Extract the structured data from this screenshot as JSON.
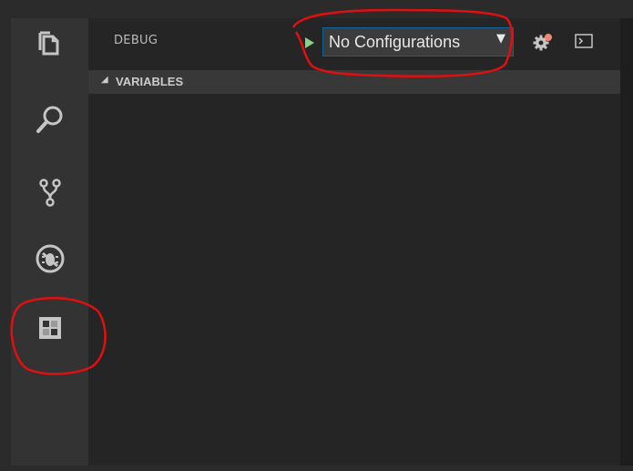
{
  "activity_bar": {
    "items": [
      {
        "icon": "explorer-icon"
      },
      {
        "icon": "search-icon"
      },
      {
        "icon": "source-control-icon"
      },
      {
        "icon": "debug-icon"
      },
      {
        "icon": "extensions-icon"
      }
    ]
  },
  "debug": {
    "title": "DEBUG",
    "configuration": "No Configurations",
    "dropdown_caret": "▼"
  },
  "variables": {
    "caret": "◢",
    "title": "VARIABLES"
  },
  "colors": {
    "activity_bar_bg": "#333333",
    "sidebar_bg": "#252526",
    "select_border": "#0e639c",
    "play_green": "#89d185",
    "gear_badge": "#f48771",
    "annotation_red": "#e01010"
  }
}
